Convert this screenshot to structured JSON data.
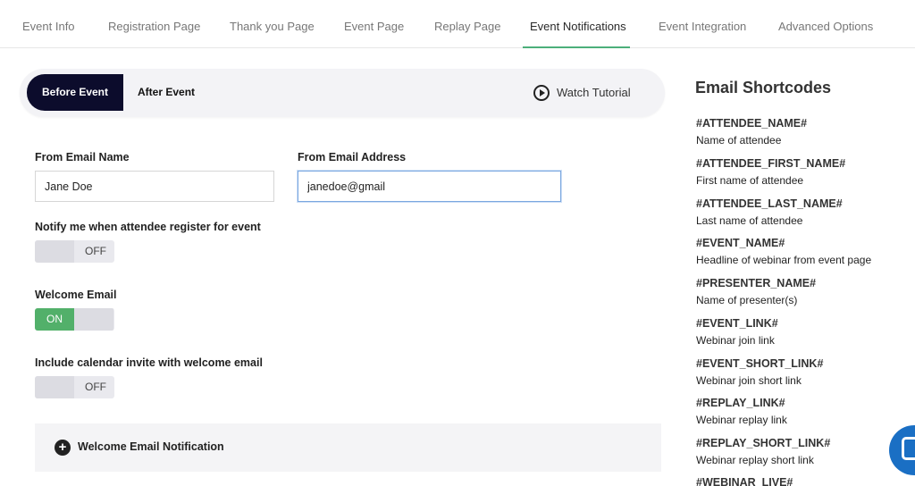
{
  "tabs": [
    "Event Info",
    "Registration Page",
    "Thank you Page",
    "Event Page",
    "Replay Page",
    "Event Notifications",
    "Event Integration",
    "Advanced Options"
  ],
  "active_tab": "Event Notifications",
  "subtabs": {
    "before": "Before Event",
    "after": "After Event"
  },
  "watch_tutorial": "Watch Tutorial",
  "form": {
    "from_name_label": "From Email Name",
    "from_name_value": "Jane Doe",
    "from_address_label": "From Email Address",
    "from_address_value": "janedoe@gmail",
    "notify_label": "Notify me when attendee register for event",
    "notify_state": "OFF",
    "welcome_label": "Welcome Email",
    "welcome_state": "ON",
    "calendar_label": "Include calendar invite with welcome email",
    "calendar_state": "OFF"
  },
  "accordion": {
    "label": "Welcome Email Notification"
  },
  "sidebar": {
    "title": "Email Shortcodes",
    "codes": [
      {
        "code": "#ATTENDEE_NAME#",
        "desc": "Name of attendee"
      },
      {
        "code": "#ATTENDEE_FIRST_NAME#",
        "desc": "First name of attendee"
      },
      {
        "code": "#ATTENDEE_LAST_NAME#",
        "desc": "Last name of attendee"
      },
      {
        "code": "#EVENT_NAME#",
        "desc": "Headline of webinar from event page"
      },
      {
        "code": "#PRESENTER_NAME#",
        "desc": "Name of presenter(s)"
      },
      {
        "code": "#EVENT_LINK#",
        "desc": "Webinar join link"
      },
      {
        "code": "#EVENT_SHORT_LINK#",
        "desc": "Webinar join short link"
      },
      {
        "code": "#REPLAY_LINK#",
        "desc": "Webinar replay link"
      },
      {
        "code": "#REPLAY_SHORT_LINK#",
        "desc": "Webinar replay short link"
      },
      {
        "code": "#WEBINAR_LIVE#",
        "desc": ""
      }
    ]
  },
  "colors": {
    "accent": "#4caf7a",
    "pill": "#0c0c2c",
    "toggle_on": "#52b06a",
    "chat": "#1a6fc4"
  }
}
